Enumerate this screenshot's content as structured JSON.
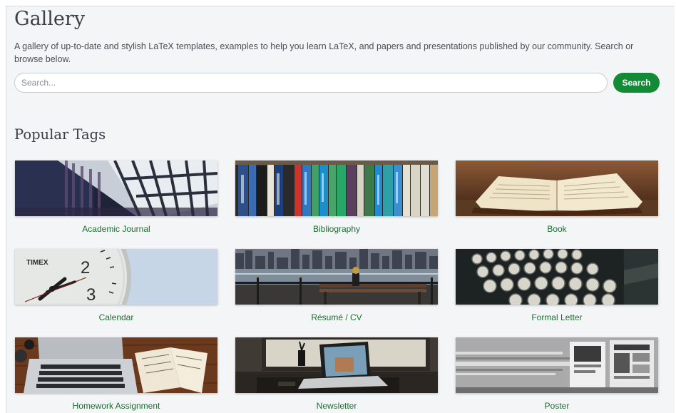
{
  "header": {
    "title": "Gallery",
    "description": "A gallery of up-to-date and stylish LaTeX templates, examples to help you learn LaTeX, and papers and presentations published by our community. Search or browse below."
  },
  "search": {
    "placeholder": "Search...",
    "value": "",
    "button_label": "Search"
  },
  "popular_tags": {
    "title": "Popular Tags",
    "items": [
      {
        "label": "Academic Journal",
        "image": "library-shelves-photo"
      },
      {
        "label": "Bibliography",
        "image": "book-spines-photo"
      },
      {
        "label": "Book",
        "image": "open-book-photo"
      },
      {
        "label": "Calendar",
        "image": "clock-face-photo"
      },
      {
        "label": "Résumé / CV",
        "image": "city-skyline-bench-photo"
      },
      {
        "label": "Formal Letter",
        "image": "typewriter-keys-photo"
      },
      {
        "label": "Homework Assignment",
        "image": "laptop-desk-photo"
      },
      {
        "label": "Newsletter",
        "image": "laptop-window-photo"
      },
      {
        "label": "Poster",
        "image": "poster-wall-photo"
      }
    ]
  },
  "colors": {
    "accent": "#138a36",
    "link": "#1b6e2f",
    "background": "#f4f5f7"
  }
}
